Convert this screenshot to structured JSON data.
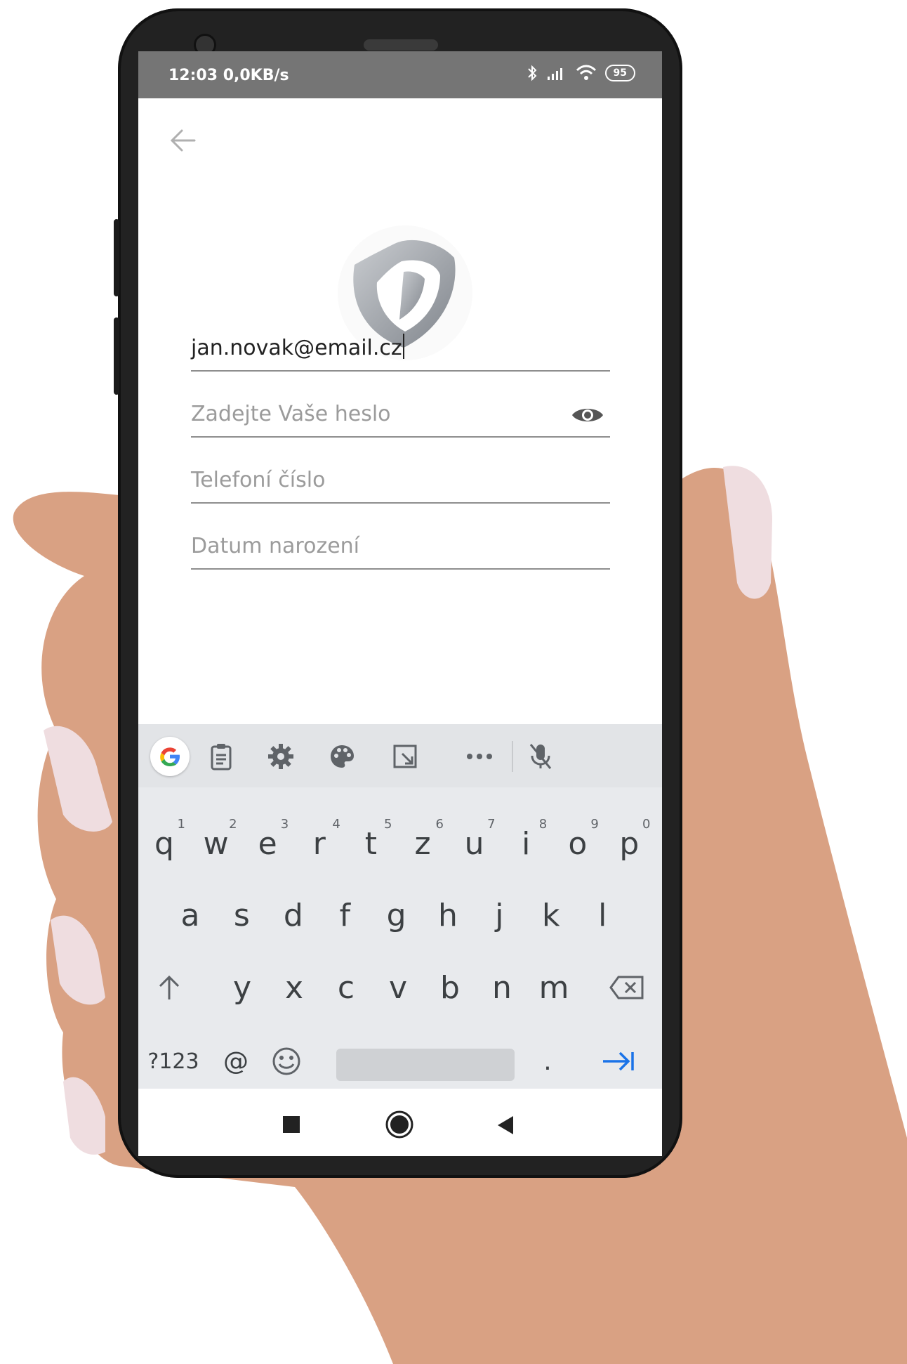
{
  "status_bar": {
    "time_speed": "12:03  0,0KB/s",
    "battery": "95"
  },
  "form": {
    "email_value": "jan.novak@email.cz",
    "password_placeholder": "Zadejte Vaše heslo",
    "phone_placeholder": "Telefoní číslo",
    "birth_placeholder": "Datum narození"
  },
  "keyboard": {
    "row1": [
      {
        "k": "q",
        "h": "1"
      },
      {
        "k": "w",
        "h": "2"
      },
      {
        "k": "e",
        "h": "3"
      },
      {
        "k": "r",
        "h": "4"
      },
      {
        "k": "t",
        "h": "5"
      },
      {
        "k": "z",
        "h": "6"
      },
      {
        "k": "u",
        "h": "7"
      },
      {
        "k": "i",
        "h": "8"
      },
      {
        "k": "o",
        "h": "9"
      },
      {
        "k": "p",
        "h": "0"
      }
    ],
    "row2": [
      "a",
      "s",
      "d",
      "f",
      "g",
      "h",
      "j",
      "k",
      "l"
    ],
    "row3": [
      "y",
      "x",
      "c",
      "v",
      "b",
      "n",
      "m"
    ],
    "sym_label": "?123",
    "at_label": "@",
    "period_label": "."
  },
  "colors": {
    "accent_blue": "#1a73e8",
    "status_gray": "#757575",
    "keyboard_bg": "#e8eaed"
  },
  "icons": [
    "back-arrow-icon",
    "shield-logo-icon",
    "eye-icon",
    "google-icon",
    "clipboard-icon",
    "settings-icon",
    "palette-icon",
    "resize-icon",
    "more-icon",
    "mic-off-icon",
    "shift-icon",
    "backspace-icon",
    "emoji-icon",
    "tab-next-icon",
    "recents-icon",
    "home-icon",
    "back-icon"
  ]
}
